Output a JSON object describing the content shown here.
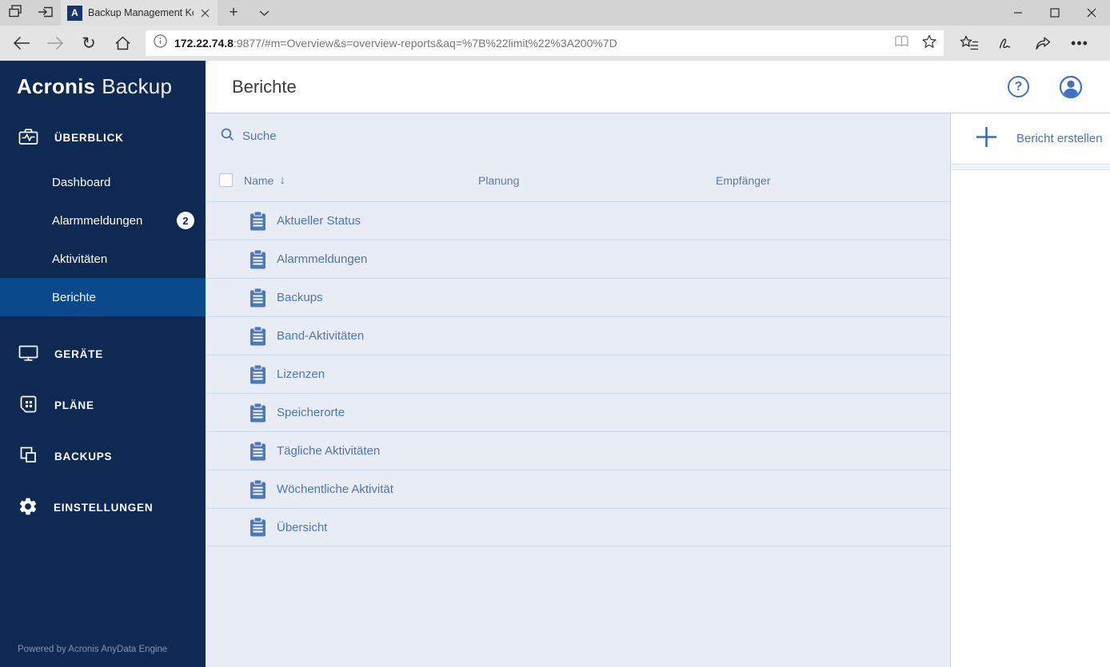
{
  "browser": {
    "tab": {
      "title": "Backup Management Ko",
      "favicon_letter": "A"
    },
    "url": {
      "host": "172.22.74.8",
      "rest": ":9877/#m=Overview&s=overview-reports&aq=%7B%22limit%22%3A200%7D"
    }
  },
  "icons": {
    "new_tab": "+",
    "refresh": "↻",
    "home": "⌂",
    "more": "•••",
    "sort_desc": "↓",
    "help": "?"
  },
  "sidebar": {
    "logo": {
      "brand": "Acronis",
      "product": "Backup"
    },
    "sections": [
      {
        "label": "ÜBERBLICK",
        "items": [
          {
            "label": "Dashboard"
          },
          {
            "label": "Alarmmeldungen",
            "badge": "2"
          },
          {
            "label": "Aktivitäten"
          },
          {
            "label": "Berichte",
            "selected": true
          }
        ]
      },
      {
        "label": "GERÄTE"
      },
      {
        "label": "PLÄNE"
      },
      {
        "label": "BACKUPS"
      },
      {
        "label": "EINSTELLUNGEN"
      }
    ],
    "footer": "Powered by Acronis AnyData Engine"
  },
  "header": {
    "title": "Berichte"
  },
  "main": {
    "search_placeholder": "Suche",
    "table": {
      "columns": [
        "Name",
        "Planung",
        "Empfänger"
      ],
      "rows": [
        {
          "name": "Aktueller Status"
        },
        {
          "name": "Alarmmeldungen"
        },
        {
          "name": "Backups"
        },
        {
          "name": "Band-Aktivitäten"
        },
        {
          "name": "Lizenzen"
        },
        {
          "name": "Speicherorte"
        },
        {
          "name": "Tägliche Aktivitäten"
        },
        {
          "name": "Wöchentliche Aktivität"
        },
        {
          "name": "Übersicht"
        }
      ]
    }
  },
  "panel": {
    "create_label": "Bericht erstellen"
  },
  "colors": {
    "sidebar_bg": "#0e2a52",
    "selected_item_bg": "#0a4a8c",
    "link_blue": "#4d76ae",
    "accent_icon_blue": "#3f72c1",
    "list_bg": "#e8ecf4"
  }
}
